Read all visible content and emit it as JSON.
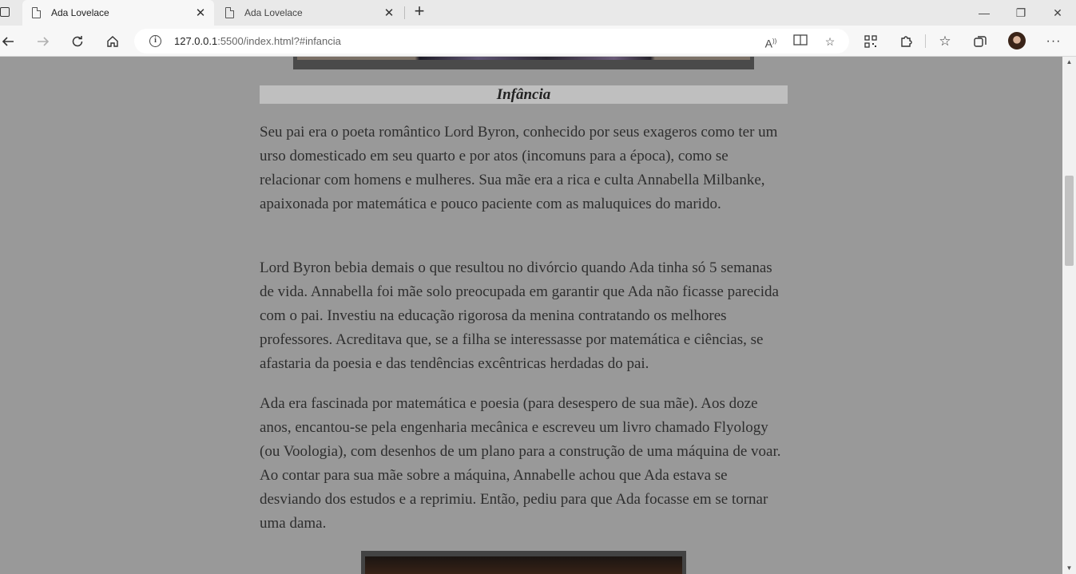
{
  "browser": {
    "tabs": [
      {
        "title": "Ada Lovelace",
        "active": true
      },
      {
        "title": "Ada Lovelace",
        "active": false
      }
    ],
    "tab_close_glyph": "✕",
    "new_tab_glyph": "+",
    "window_controls": {
      "minimize": "—",
      "restore": "❐",
      "close": "✕"
    },
    "url_host": "127.0.0.1",
    "url_rest": ":5500/index.html?#infancia"
  },
  "page": {
    "section_heading": "Infância",
    "paragraphs": [
      "Seu pai era o poeta romântico Lord Byron, conhecido por seus exageros como ter um urso domesticado em seu quarto e por atos (incomuns para a época), como se relacionar com homens e mulheres. Sua mãe era a rica e culta Annabella Milbanke, apaixonada por matemática e pouco paciente com as maluquices do marido.",
      "Lord Byron bebia demais o que resultou no divórcio quando Ada tinha só 5 semanas de vida. Annabella foi mãe solo preocupada em garantir que Ada não ficasse parecida com o pai. Investiu na educação rigorosa da menina contratando os melhores professores. Acreditava que, se a filha se interessasse por matemática e ciências, se afastaria da poesia e das tendências excêntricas herdadas do pai.",
      "Ada era fascinada por matemática e poesia (para desespero de sua mãe). Aos doze anos, encantou-se pela engenharia mecânica e escreveu um livro chamado Flyology (ou Voologia), com desenhos de um plano para a construção de uma máquina de voar. Ao contar para sua mãe sobre a máquina, Annabelle achou que Ada estava se desviando dos estudos e a reprimiu. Então, pediu para que Ada focasse em se tornar uma dama."
    ]
  },
  "colors": {
    "page_background": "#999999",
    "heading_background": "#bfbfbf",
    "image_frame": "#434343"
  },
  "icons": {
    "back": "back-arrow-icon",
    "forward": "forward-arrow-icon",
    "refresh": "refresh-icon",
    "home": "home-icon",
    "info": "info-icon",
    "read_aloud": "read-aloud-icon",
    "immersive_reader": "immersive-reader-icon",
    "add_favorite": "add-favorite-icon",
    "qr_code": "qr-code-icon",
    "extensions": "extensions-icon",
    "favorites": "favorites-icon",
    "collections": "collections-icon",
    "more": "more-icon"
  }
}
